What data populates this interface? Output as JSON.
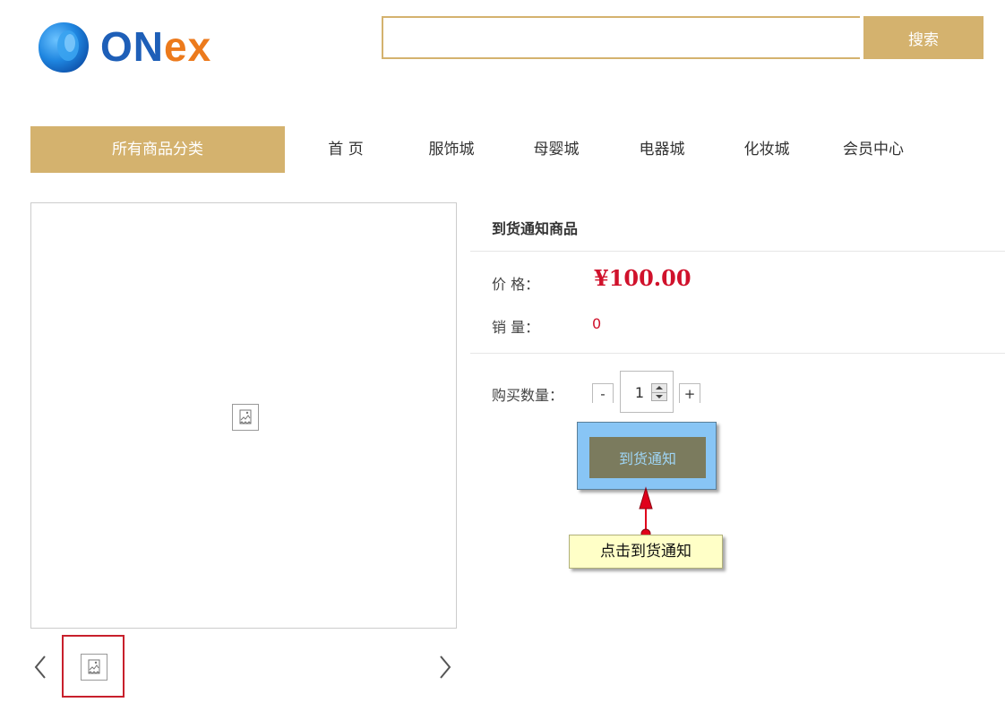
{
  "header": {
    "logo": {
      "text_part1": "ON",
      "text_part2": "ex"
    },
    "search": {
      "value": "",
      "button_label": "搜索"
    }
  },
  "nav": {
    "categories_label": "所有商品分类",
    "items": [
      {
        "label": "首 页"
      },
      {
        "label": "服饰城"
      },
      {
        "label": "母婴城"
      },
      {
        "label": "电器城"
      },
      {
        "label": "化妆城"
      },
      {
        "label": "会员中心"
      }
    ]
  },
  "gallery": {
    "main_image_icon": "broken-image-icon",
    "thumbnail_icon": "broken-image-icon",
    "prev_icon": "chevron-left-icon",
    "next_icon": "chevron-right-icon"
  },
  "product": {
    "title": "到货通知商品",
    "price_label": "价 格：",
    "price_value": "¥100.00",
    "sales_label": "销 量：",
    "sales_value": "0",
    "quantity_label": "购买数量：",
    "quantity_value": "1",
    "minus_label": "-",
    "plus_label": "+",
    "notify_button_label": "到货通知"
  },
  "annotation": {
    "callout_text": "点击到货通知"
  },
  "colors": {
    "accent_gold": "#d4b26e",
    "price_red": "#d0112b",
    "logo_blue": "#1e5fb8",
    "logo_orange": "#ec7a1c",
    "highlight_blue": "#88c5f5",
    "callout_yellow": "#ffffc7",
    "annotation_red": "#e0001b",
    "thumb_border_red": "#c8202c"
  }
}
